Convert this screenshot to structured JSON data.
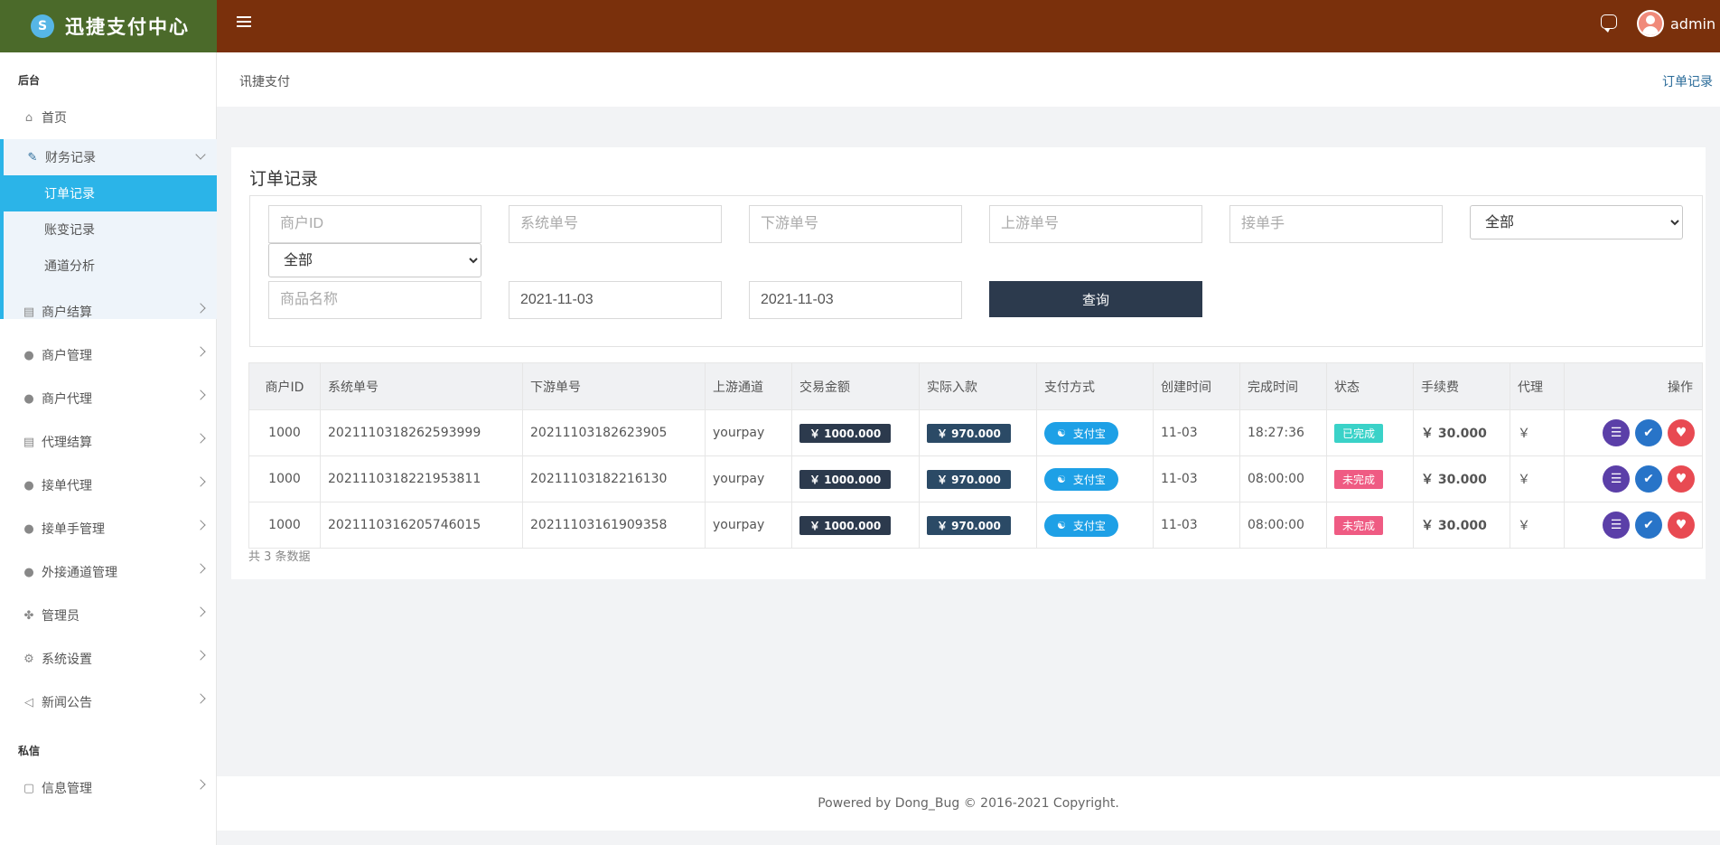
{
  "app": {
    "title": "迅捷支付中心",
    "username": "admin"
  },
  "breadcrumb": {
    "left": "讯捷支付",
    "right": "订单记录"
  },
  "sidebar": {
    "section_backend": "后台",
    "section_private": "私信",
    "items": [
      {
        "label": "首页"
      },
      {
        "label": "财务记录"
      },
      {
        "label": "商户结算"
      },
      {
        "label": "商户管理"
      },
      {
        "label": "商户代理"
      },
      {
        "label": "代理结算"
      },
      {
        "label": "接单代理"
      },
      {
        "label": "接单手管理"
      },
      {
        "label": "外接通道管理"
      },
      {
        "label": "管理员"
      },
      {
        "label": "系统设置"
      },
      {
        "label": "新闻公告"
      },
      {
        "label": "信息管理"
      }
    ],
    "sub_items": [
      {
        "label": "订单记录"
      },
      {
        "label": "账变记录"
      },
      {
        "label": "通道分析"
      }
    ]
  },
  "page": {
    "title": "订单记录",
    "filters": {
      "merchant_id_placeholder": "商户ID",
      "system_no_placeholder": "系统单号",
      "downstream_no_placeholder": "下游单号",
      "upstream_no_placeholder": "上游单号",
      "receiver_placeholder": "接单手",
      "select_all_1": "全部",
      "select_all_2": "全部",
      "product_placeholder": "商品名称",
      "date_start": "2021-11-03",
      "date_end": "2021-11-03",
      "query_label": "查询"
    },
    "table": {
      "headers": [
        "商户ID",
        "系统单号",
        "下游单号",
        "上游通道",
        "交易金额",
        "实际入款",
        "支付方式",
        "创建时间",
        "完成时间",
        "状态",
        "手续费",
        "代理",
        "操作"
      ],
      "rows": [
        {
          "merchant_id": "1000",
          "system_no": "2021110318262593999",
          "downstream_no": "20211103182623905",
          "channel": "yourpay",
          "amount": "￥ 1000.000",
          "actual": "￥ 970.000",
          "pay_method": "支付宝",
          "created": "11-03",
          "finished": "18:27:36",
          "status": "已完成",
          "fee": "￥ 30.000",
          "agent": "￥"
        },
        {
          "merchant_id": "1000",
          "system_no": "2021110318221953811",
          "downstream_no": "20211103182216130",
          "channel": "yourpay",
          "amount": "￥ 1000.000",
          "actual": "￥ 970.000",
          "pay_method": "支付宝",
          "created": "11-03",
          "finished": "08:00:00",
          "status": "未完成",
          "fee": "￥ 30.000",
          "agent": "￥"
        },
        {
          "merchant_id": "1000",
          "system_no": "2021110316205746015",
          "downstream_no": "20211103161909358",
          "channel": "yourpay",
          "amount": "￥ 1000.000",
          "actual": "￥ 970.000",
          "pay_method": "支付宝",
          "created": "11-03",
          "finished": "08:00:00",
          "status": "未完成",
          "fee": "￥ 30.000",
          "agent": "￥"
        }
      ]
    },
    "total_text": "共 3 条数据"
  },
  "footer": {
    "text": "Powered by Dong_Bug © 2016-2021 Copyright."
  },
  "colors": {
    "header": "#7a300c",
    "brand_bg": "#4b6a2a",
    "active_blue": "#2bb4e8",
    "dark_btn": "#2c3a4d"
  }
}
